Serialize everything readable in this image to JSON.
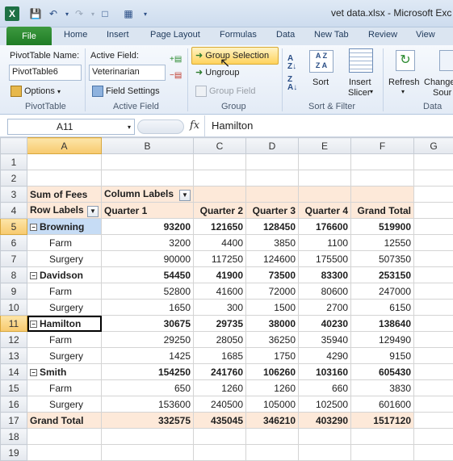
{
  "window": {
    "title": "vet data.xlsx - Microsoft Exc",
    "app_icon": "X"
  },
  "quick_access": {
    "save_icon": "save-icon",
    "undo_icon": "undo-icon",
    "redo_icon": "redo-icon",
    "new_icon": "new-document-icon",
    "form_icon": "form-icon"
  },
  "tabs": [
    "File",
    "Home",
    "Insert",
    "Page Layout",
    "Formulas",
    "Data",
    "New Tab",
    "Review",
    "View"
  ],
  "ribbon": {
    "pivottable": {
      "name_label": "PivotTable Name:",
      "name_value": "PivotTable6",
      "options_label": "Options",
      "group_label": "PivotTable"
    },
    "active_field": {
      "label": "Active Field:",
      "value": "Veterinarian",
      "settings_label": "Field Settings",
      "group_label": "Active Field"
    },
    "group": {
      "group_selection": "Group Selection",
      "ungroup": "Ungroup",
      "group_field": "Group Field",
      "group_label": "Group"
    },
    "sort_filter": {
      "sort": "Sort",
      "insert_slicer_1": "Insert",
      "insert_slicer_2": "Slicer",
      "group_label": "Sort & Filter"
    },
    "data": {
      "refresh": "Refresh",
      "change_1": "Change",
      "change_2": "Sour",
      "group_label": "Data"
    }
  },
  "formula_bar": {
    "name_box": "A11",
    "fx": "fx",
    "formula": "Hamilton"
  },
  "columns": [
    "A",
    "B",
    "C",
    "D",
    "E",
    "F",
    "G"
  ],
  "rows": [
    {
      "n": "1",
      "cells": [
        "",
        "",
        "",
        "",
        "",
        ""
      ]
    },
    {
      "n": "2",
      "cells": [
        "",
        "",
        "",
        "",
        "",
        ""
      ]
    },
    {
      "n": "3",
      "cells": [
        "Sum of Fees",
        "Column Labels",
        "",
        "",
        "",
        ""
      ]
    },
    {
      "n": "4",
      "cells": [
        "Row Labels",
        "Quarter 1",
        "Quarter 2",
        "Quarter 3",
        "Quarter 4",
        "Grand Total"
      ]
    },
    {
      "n": "5",
      "cells": [
        "Browning",
        "93200",
        "121650",
        "128450",
        "176600",
        "519900"
      ]
    },
    {
      "n": "6",
      "cells": [
        "Farm",
        "3200",
        "4400",
        "3850",
        "1100",
        "12550"
      ]
    },
    {
      "n": "7",
      "cells": [
        "Surgery",
        "90000",
        "117250",
        "124600",
        "175500",
        "507350"
      ]
    },
    {
      "n": "8",
      "cells": [
        "Davidson",
        "54450",
        "41900",
        "73500",
        "83300",
        "253150"
      ]
    },
    {
      "n": "9",
      "cells": [
        "Farm",
        "52800",
        "41600",
        "72000",
        "80600",
        "247000"
      ]
    },
    {
      "n": "10",
      "cells": [
        "Surgery",
        "1650",
        "300",
        "1500",
        "2700",
        "6150"
      ]
    },
    {
      "n": "11",
      "cells": [
        "Hamilton",
        "30675",
        "29735",
        "38000",
        "40230",
        "138640"
      ]
    },
    {
      "n": "12",
      "cells": [
        "Farm",
        "29250",
        "28050",
        "36250",
        "35940",
        "129490"
      ]
    },
    {
      "n": "13",
      "cells": [
        "Surgery",
        "1425",
        "1685",
        "1750",
        "4290",
        "9150"
      ]
    },
    {
      "n": "14",
      "cells": [
        "Smith",
        "154250",
        "241760",
        "106260",
        "103160",
        "605430"
      ]
    },
    {
      "n": "15",
      "cells": [
        "Farm",
        "650",
        "1260",
        "1260",
        "660",
        "3830"
      ]
    },
    {
      "n": "16",
      "cells": [
        "Surgery",
        "153600",
        "240500",
        "105000",
        "102500",
        "601600"
      ]
    },
    {
      "n": "17",
      "cells": [
        "Grand Total",
        "332575",
        "435045",
        "346210",
        "403290",
        "1517120"
      ]
    },
    {
      "n": "18",
      "cells": [
        "",
        "",
        "",
        "",
        "",
        ""
      ]
    },
    {
      "n": "19",
      "cells": [
        "",
        "",
        "",
        "",
        "",
        ""
      ]
    }
  ],
  "colors": {
    "pivot_header": "#fde9d9",
    "selected_header": "#f7c96e",
    "file_tab": "#2a8a2f"
  }
}
